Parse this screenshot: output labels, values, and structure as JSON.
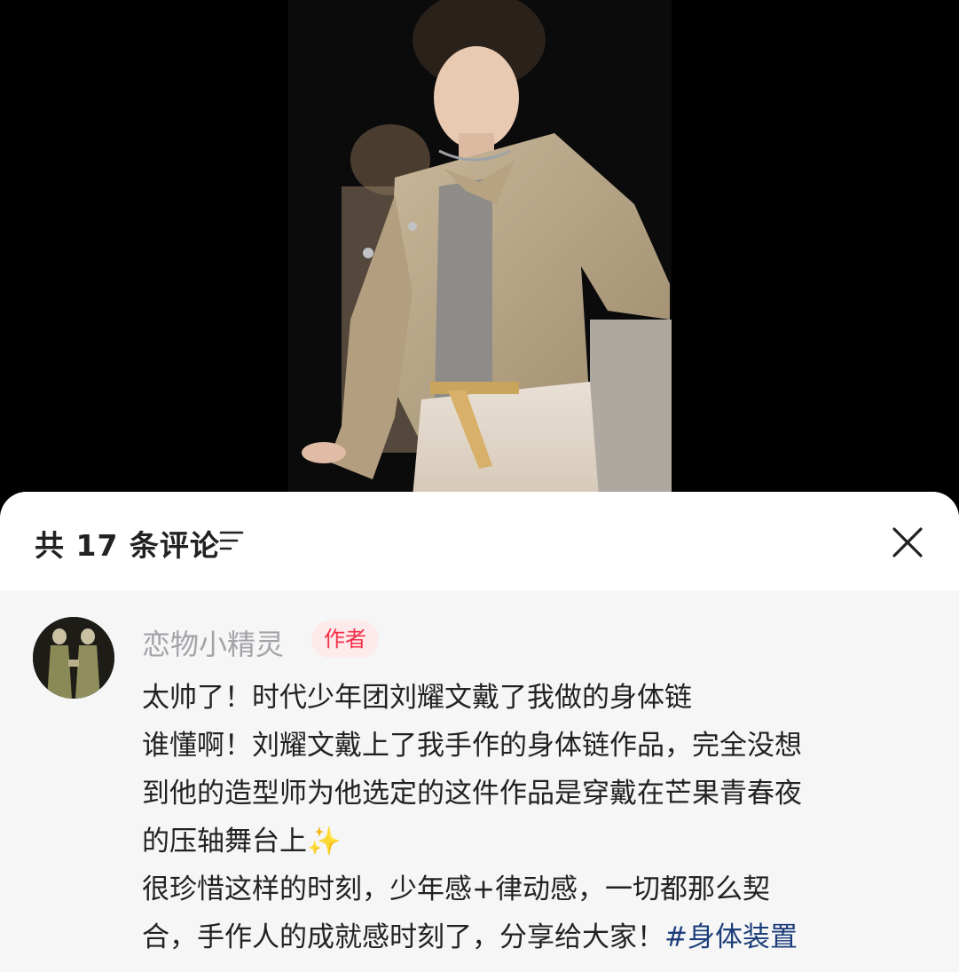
{
  "comments": {
    "count_label": "共 17 条评论",
    "sort_icon": "sort-lines-icon",
    "close_icon": "close-icon"
  },
  "comment": {
    "username": "恋物小精灵",
    "badge": "作者",
    "lines": [
      "太帅了！时代少年团刘耀文戴了我做的身体链",
      "谁懂啊！刘耀文戴上了我手作的身体链作品，完全没想",
      "到他的造型师为他选定的这件作品是穿戴在芒果青春夜",
      "的压轴舞台上",
      "很珍惜这样的时刻，少年感+律动感，一切都那么契",
      "合，手作人的成就感时刻了，分享给大家！"
    ],
    "emoji": "✨",
    "hashtag": "#身体装置",
    "badge_color": "#f5304a",
    "hashtag_color": "#1c3e7a"
  }
}
